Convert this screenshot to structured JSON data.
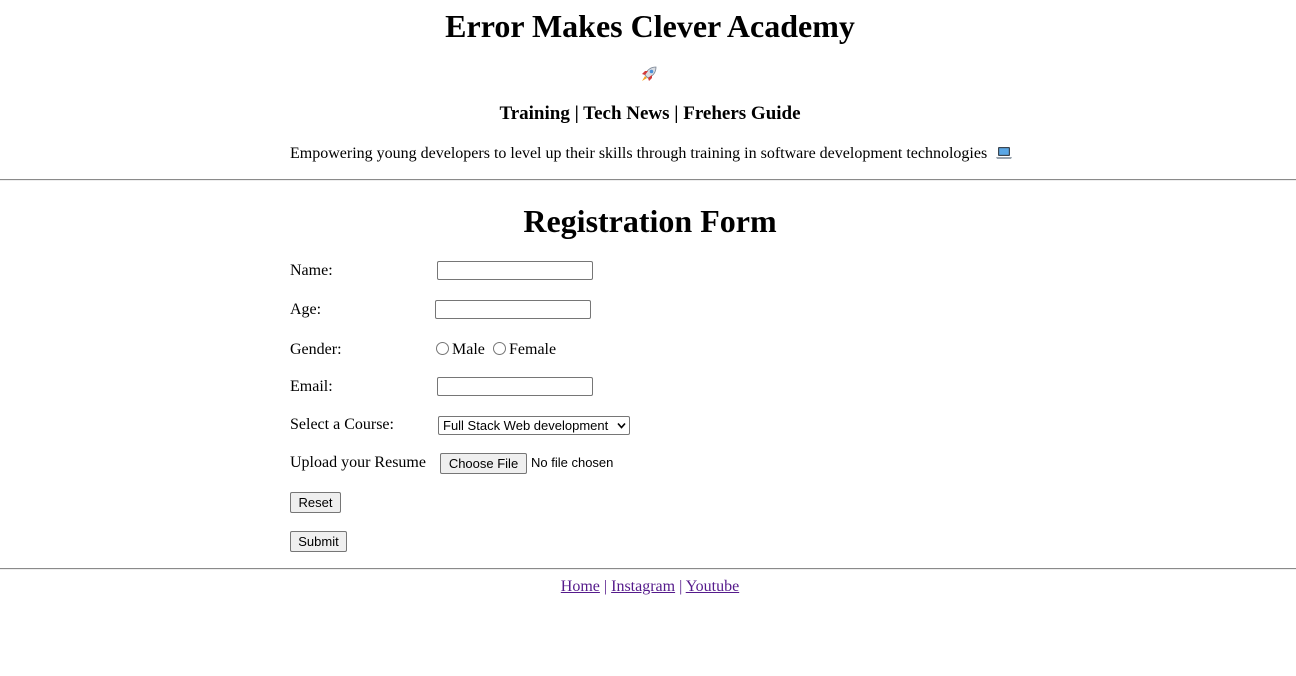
{
  "header": {
    "title": "Error Makes Clever Academy",
    "rocket_icon": "rocket-icon",
    "nav_text": "Training | Tech News | Frehers Guide",
    "tagline": "Empowering young developers to level up their skills through training in software development technologies",
    "laptop_icon": "laptop-icon"
  },
  "form": {
    "title": "Registration Form",
    "name_label": "Name:",
    "name_value": "",
    "age_label": "Age:",
    "age_value": "",
    "gender_label": "Gender:",
    "gender_options": [
      "Male",
      "Female"
    ],
    "email_label": "Email:",
    "email_value": "",
    "course_label": "Select a Course:",
    "course_selected": "Full Stack Web development",
    "resume_label": "Upload your Resume",
    "file_button": "Choose File",
    "file_status": "No file chosen",
    "reset_label": "Reset",
    "submit_label": "Submit"
  },
  "footer": {
    "links": [
      "Home",
      "Instagram",
      "Youtube"
    ],
    "separator": "|",
    "link_color": "#551a8b"
  }
}
